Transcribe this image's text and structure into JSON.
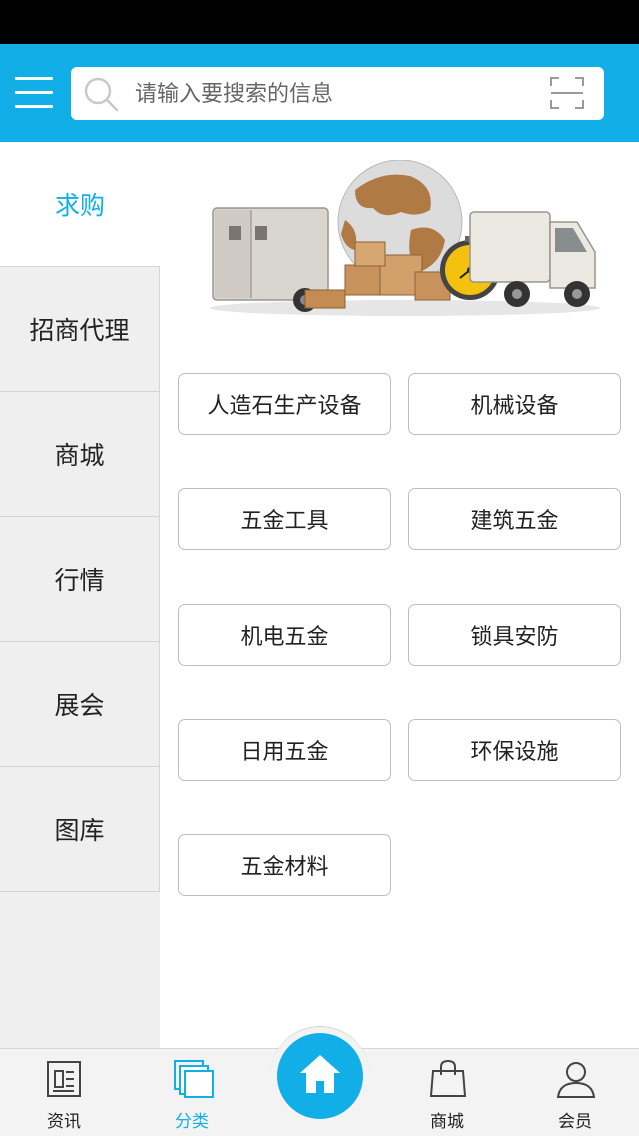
{
  "header": {
    "search_placeholder": "请输入要搜索的信息",
    "accent_color": "#12aee8"
  },
  "sidebar": {
    "items": [
      {
        "label": "求购",
        "active": true
      },
      {
        "label": "招商代理",
        "active": false
      },
      {
        "label": "商城",
        "active": false
      },
      {
        "label": "行情",
        "active": false
      },
      {
        "label": "展会",
        "active": false
      },
      {
        "label": "图库",
        "active": false
      }
    ]
  },
  "categories": [
    "人造石生产设备",
    "机械设备",
    "五金工具",
    "建筑五金",
    "机电五金",
    "锁具安防",
    "日用五金",
    "环保设施",
    "五金材料"
  ],
  "tabbar": {
    "items": [
      {
        "label": "资讯",
        "icon": "newspaper-icon"
      },
      {
        "label": "分类",
        "icon": "layers-icon",
        "active": true
      },
      {
        "label": "",
        "icon": "home-icon"
      },
      {
        "label": "商城",
        "icon": "shopping-bag-icon"
      },
      {
        "label": "会员",
        "icon": "user-icon"
      }
    ]
  }
}
